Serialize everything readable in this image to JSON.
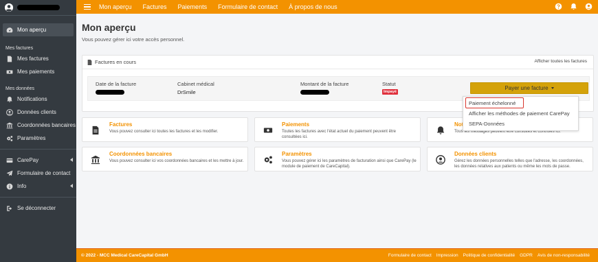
{
  "sidebar": {
    "user_name_redacted": true,
    "overview": "Mon aperçu",
    "section_invoices": "Mes factures",
    "my_invoices": "Mes factures",
    "my_payments": "Mes paiements",
    "section_data": "Mes données",
    "notifications": "Notifications",
    "client_data": "Données clients",
    "bank_details": "Coordonnées bancaires",
    "settings": "Paramètres",
    "carepay": "CarePay",
    "contact_form": "Formulaire de contact",
    "info": "Info",
    "logout": "Se déconnecter"
  },
  "topbar": {
    "nav": [
      "Mon aperçu",
      "Factures",
      "Paiements",
      "Formulaire de contact",
      "À propos de nous"
    ],
    "icons": [
      "help-icon",
      "bell-icon",
      "user-circle-icon"
    ]
  },
  "main": {
    "title": "Mon aperçu",
    "subtitle": "Vous pouvez gérer ici votre accès personnel."
  },
  "invoices": {
    "header": "Factures en cours",
    "show_all": "Afficher toutes les factures",
    "date_label": "Date de la facture",
    "cabinet_label": "Cabinet médical",
    "cabinet_value": "DrSmile",
    "amount_label": "Montant de la facture",
    "status_label": "Statut",
    "status_value": "Impayé",
    "pay_button": "Payer une facture"
  },
  "dropdown": {
    "items": [
      "Paiement échelonné",
      "Afficher les méthodes de paiement CarePay",
      "SEPA-Données"
    ]
  },
  "tiles": [
    {
      "title": "Factures",
      "desc": "Vous pouvez consulter ici toutes les factures et les modifier."
    },
    {
      "title": "Paiements",
      "desc": "Toutes les factures avec l'état actuel du paiement peuvent être consultées ici."
    },
    {
      "title": "Not",
      "desc": "Tous les messages peuvent être consultés et contrôlés ici."
    },
    {
      "title": "Coordonnées bancaires",
      "desc": "Vous pouvez consulter ici vos coordonnées bancaires et les mettre à jour."
    },
    {
      "title": "Paramètres",
      "desc": "Vous pouvez gérer ici les paramètres de facturation ainsi que CarePay (le module de paiement de CareCapital)."
    },
    {
      "title": "Données clients",
      "desc": "Gérez les données personnelles telles que l'adresse, les coordonnées, les données relatives aux patients ou même les mots de passe."
    }
  ],
  "footer": {
    "copyright": "© 2022 - MCC Medical CareCapital GmbH",
    "links": [
      "Formulaire de contact",
      "Impression",
      "Politique de confidentialité",
      "GDPR",
      "Avis de non-responsabilité"
    ]
  },
  "colors": {
    "accent": "#f39200",
    "sidebar_bg": "#343a40",
    "button": "#d4a20a",
    "danger": "#e0303c"
  }
}
